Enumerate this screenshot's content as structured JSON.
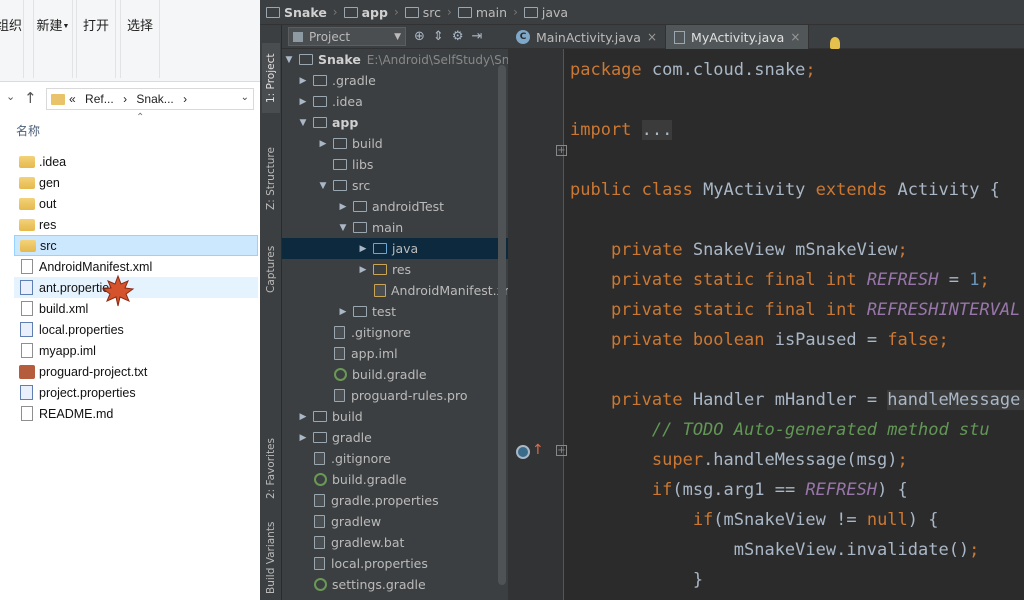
{
  "explorer": {
    "ribbon": {
      "organize": "组织",
      "new": "新建",
      "open": "打开",
      "select": "选择"
    },
    "address": {
      "crumbs": [
        "«",
        "Ref...",
        "›",
        "Snak...",
        "›"
      ]
    },
    "column_header": "名称",
    "files": [
      {
        "name": ".idea",
        "type": "folder"
      },
      {
        "name": "gen",
        "type": "folder"
      },
      {
        "name": "out",
        "type": "folder"
      },
      {
        "name": "res",
        "type": "folder"
      },
      {
        "name": "src",
        "type": "folder"
      },
      {
        "name": "AndroidManifest.xml",
        "type": "file"
      },
      {
        "name": "ant.properties",
        "type": "gear"
      },
      {
        "name": "build.xml",
        "type": "file"
      },
      {
        "name": "local.properties",
        "type": "gear"
      },
      {
        "name": "myapp.iml",
        "type": "file"
      },
      {
        "name": "proguard-project.txt",
        "type": "book"
      },
      {
        "name": "project.properties",
        "type": "gear"
      },
      {
        "name": "README.md",
        "type": "file"
      }
    ]
  },
  "ide": {
    "breadcrumb": [
      "Snake",
      "app",
      "src",
      "main",
      "java"
    ],
    "side_tabs": {
      "project": "1: Project",
      "structure": "Z: Structure",
      "captures": "Captures",
      "favorites": "2: Favorites",
      "variants": "Build Variants"
    },
    "project_view_label": "Project",
    "tree_root": {
      "name": "Snake",
      "path": "E:\\Android\\SelfStudy\\Snake"
    },
    "tree": [
      {
        "name": ".gradle",
        "depth": 0,
        "arrow": "▶",
        "icon": "folder"
      },
      {
        "name": ".idea",
        "depth": 0,
        "arrow": "▶",
        "icon": "folder"
      },
      {
        "name": "app",
        "depth": 0,
        "arrow": "▼",
        "icon": "folder",
        "bold": true
      },
      {
        "name": "build",
        "depth": 1,
        "arrow": "▶",
        "icon": "folder"
      },
      {
        "name": "libs",
        "depth": 1,
        "arrow": "",
        "icon": "folder"
      },
      {
        "name": "src",
        "depth": 1,
        "arrow": "▼",
        "icon": "folder"
      },
      {
        "name": "androidTest",
        "depth": 2,
        "arrow": "▶",
        "icon": "folder"
      },
      {
        "name": "main",
        "depth": 2,
        "arrow": "▼",
        "icon": "folder"
      },
      {
        "name": "java",
        "depth": 3,
        "arrow": "▶",
        "icon": "src",
        "selected": true
      },
      {
        "name": "res",
        "depth": 3,
        "arrow": "▶",
        "icon": "res"
      },
      {
        "name": "AndroidManifest.xml",
        "depth": 3,
        "arrow": "",
        "icon": "xml"
      },
      {
        "name": "test",
        "depth": 2,
        "arrow": "▶",
        "icon": "folder"
      },
      {
        "name": ".gitignore",
        "depth": 1,
        "arrow": "",
        "icon": "file"
      },
      {
        "name": "app.iml",
        "depth": 1,
        "arrow": "",
        "icon": "file"
      },
      {
        "name": "build.gradle",
        "depth": 1,
        "arrow": "",
        "icon": "gradle"
      },
      {
        "name": "proguard-rules.pro",
        "depth": 1,
        "arrow": "",
        "icon": "file"
      },
      {
        "name": "build",
        "depth": 0,
        "arrow": "▶",
        "icon": "folder"
      },
      {
        "name": "gradle",
        "depth": 0,
        "arrow": "▶",
        "icon": "folder"
      },
      {
        "name": ".gitignore",
        "depth": 0,
        "arrow": "",
        "icon": "file"
      },
      {
        "name": "build.gradle",
        "depth": 0,
        "arrow": "",
        "icon": "gradle"
      },
      {
        "name": "gradle.properties",
        "depth": 0,
        "arrow": "",
        "icon": "file"
      },
      {
        "name": "gradlew",
        "depth": 0,
        "arrow": "",
        "icon": "file"
      },
      {
        "name": "gradlew.bat",
        "depth": 0,
        "arrow": "",
        "icon": "file"
      },
      {
        "name": "local.properties",
        "depth": 0,
        "arrow": "",
        "icon": "file"
      },
      {
        "name": "settings.gradle",
        "depth": 0,
        "arrow": "",
        "icon": "gradle"
      }
    ],
    "tabs": [
      {
        "label": "MainActivity.java",
        "active": false,
        "icon": "C"
      },
      {
        "label": "MyActivity.java",
        "active": true,
        "icon": "file"
      }
    ],
    "code": [
      [
        {
          "t": "package ",
          "c": "kw"
        },
        {
          "t": "com.cloud.snake",
          "c": ""
        },
        {
          "t": ";",
          "c": "kw"
        }
      ],
      [],
      [
        {
          "t": "import ",
          "c": "kw"
        },
        {
          "t": "...",
          "c": "fold"
        }
      ],
      [],
      [
        {
          "t": "public class ",
          "c": "kw"
        },
        {
          "t": "MyActivity ",
          "c": ""
        },
        {
          "t": "extends ",
          "c": "kw"
        },
        {
          "t": "Activity {",
          "c": ""
        }
      ],
      [],
      [
        {
          "t": "    private ",
          "c": "kw"
        },
        {
          "t": "SnakeView mSnakeView",
          "c": ""
        },
        {
          "t": ";",
          "c": "kw"
        }
      ],
      [
        {
          "t": "    private static final int ",
          "c": "kw"
        },
        {
          "t": "REFRESH",
          "c": "it"
        },
        {
          "t": " = ",
          "c": ""
        },
        {
          "t": "1",
          "c": "num"
        },
        {
          "t": ";",
          "c": "kw"
        }
      ],
      [
        {
          "t": "    private static final int ",
          "c": "kw"
        },
        {
          "t": "REFRESHINTERVAL",
          "c": "it"
        },
        {
          "t": " = ",
          "c": ""
        }
      ],
      [
        {
          "t": "    private boolean ",
          "c": "kw"
        },
        {
          "t": "isPaused",
          "c": ""
        },
        {
          "t": " = ",
          "c": ""
        },
        {
          "t": "false",
          "c": "kw"
        },
        {
          "t": ";",
          "c": "kw"
        }
      ],
      [],
      [
        {
          "t": "    private ",
          "c": "kw"
        },
        {
          "t": "Handler mHandler = ",
          "c": ""
        },
        {
          "t": "handleMessage(m",
          "c": "hl"
        }
      ],
      [
        {
          "t": "        // TODO Auto-generated method stu",
          "c": "cmt"
        }
      ],
      [
        {
          "t": "        super",
          "c": "kw"
        },
        {
          "t": ".handleMessage(msg)",
          "c": ""
        },
        {
          "t": ";",
          "c": "kw"
        }
      ],
      [
        {
          "t": "        if",
          "c": "kw"
        },
        {
          "t": "(msg.arg1 == ",
          "c": ""
        },
        {
          "t": "REFRESH",
          "c": "it"
        },
        {
          "t": ") {",
          "c": ""
        }
      ],
      [
        {
          "t": "            if",
          "c": "kw"
        },
        {
          "t": "(mSnakeView != ",
          "c": ""
        },
        {
          "t": "null",
          "c": "kw"
        },
        {
          "t": ") {",
          "c": ""
        }
      ],
      [
        {
          "t": "                mSnakeView.invalidate()",
          "c": ""
        },
        {
          "t": ";",
          "c": "kw"
        }
      ],
      [
        {
          "t": "            }",
          "c": ""
        }
      ]
    ]
  }
}
